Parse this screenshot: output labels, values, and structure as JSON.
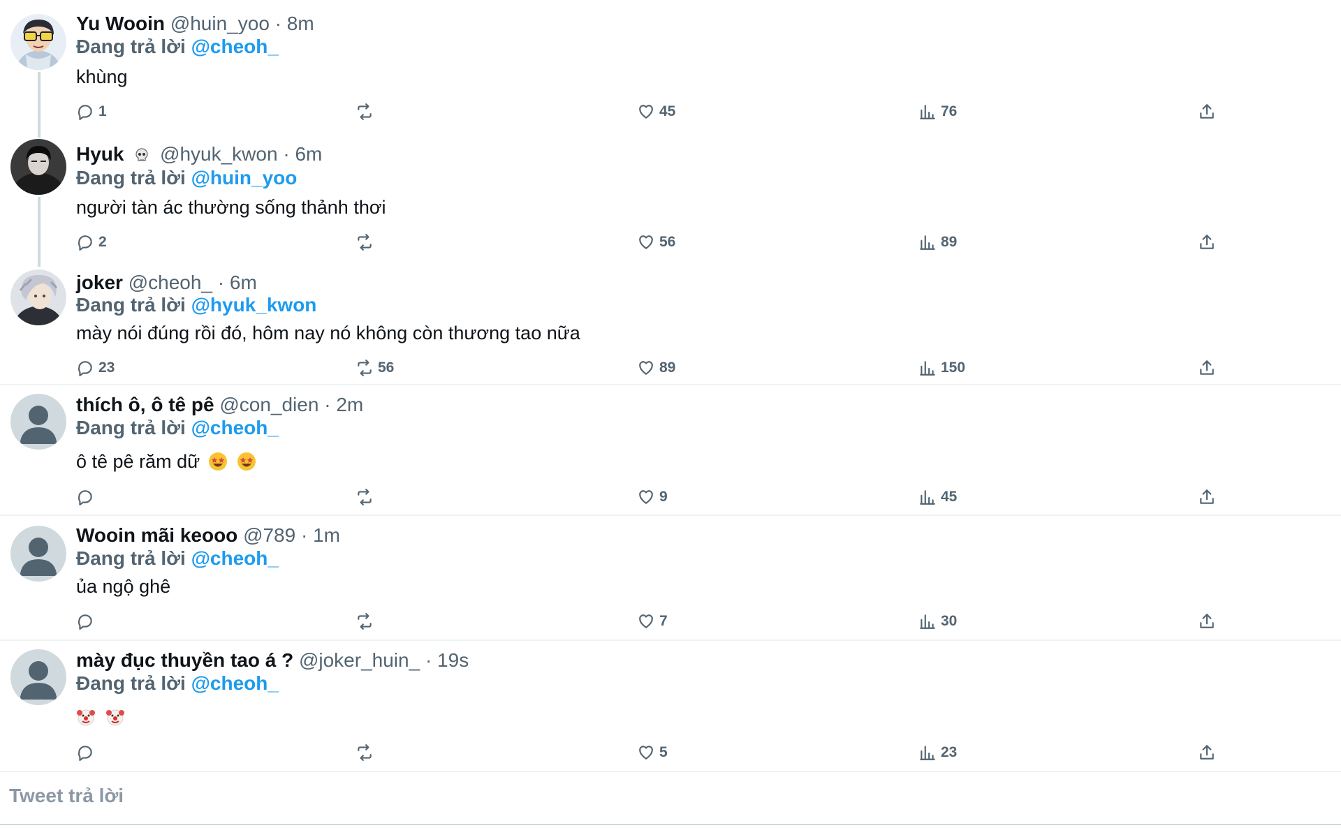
{
  "accent_color": "#1d9bf0",
  "reply_prefix": "Đang trả lời",
  "tweets": [
    {
      "name": "Yu Wooin",
      "handle": "@huin_yoo",
      "dot": "·",
      "time": "8m",
      "reply_to": "@cheoh_",
      "text": "khùng",
      "replies": "1",
      "retweets": "",
      "likes": "45",
      "views": "76"
    },
    {
      "name": "Hyuk",
      "name_emoji": "skull-icon",
      "handle": "@hyuk_kwon",
      "dot": "·",
      "time": "6m",
      "reply_to": "@huin_yoo",
      "text": "người tàn ác thường sống thảnh thơi",
      "replies": "2",
      "retweets": "",
      "likes": "56",
      "views": "89"
    },
    {
      "name": "joker",
      "handle": "@cheoh_",
      "dot": "·",
      "time": "6m",
      "reply_to": "@hyuk_kwon",
      "text": "mày nói đúng rồi đó, hôm nay nó không còn thương tao nữa",
      "replies": "23",
      "retweets": "56",
      "likes": "89",
      "views": "150"
    },
    {
      "name": "thích ô, ô tê pê",
      "handle": "@con_dien",
      "dot": "·",
      "time": "2m",
      "reply_to": "@cheoh_",
      "text": "ô tê pê răm dữ",
      "text_emojis": [
        "star-struck-emoji",
        "star-struck-emoji"
      ],
      "replies": "",
      "retweets": "",
      "likes": "9",
      "views": "45"
    },
    {
      "name": "Wooin mãi keooo",
      "handle": "@789",
      "dot": "·",
      "time": "1m",
      "reply_to": "@cheoh_",
      "text": "ủa ngộ ghê",
      "replies": "",
      "retweets": "",
      "likes": "7",
      "views": "30"
    },
    {
      "name": "mày đục thuyền tao á ?",
      "handle": "@joker_huin_",
      "dot": "·",
      "time": "19s",
      "reply_to": "@cheoh_",
      "text": "",
      "text_emojis": [
        "clown-emoji",
        "clown-emoji"
      ],
      "replies": "",
      "retweets": "",
      "likes": "5",
      "views": "23"
    }
  ],
  "compose": {
    "placeholder": "Tweet trả lời"
  }
}
